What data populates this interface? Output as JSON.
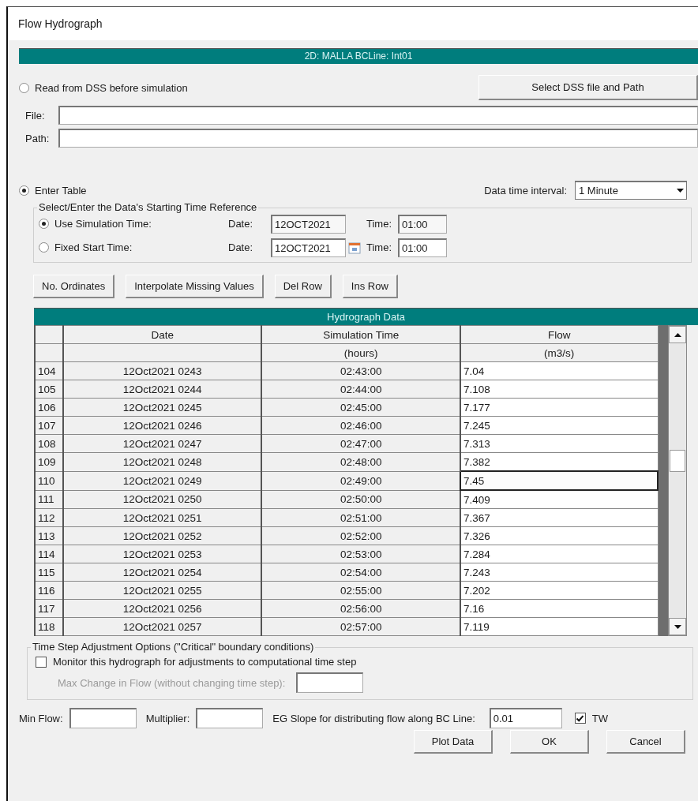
{
  "window": {
    "title": "Flow Hydrograph"
  },
  "header_bar": "2D: MALLA BCLine: Int01",
  "dss": {
    "label": "Read from DSS before simulation",
    "selected": false,
    "button": "Select DSS file and Path",
    "fields": [
      {
        "label": "File:"
      },
      {
        "label": "Path:"
      }
    ]
  },
  "table_entry": {
    "label": "Enter Table",
    "selected": true,
    "interval_label": "Data time interval:",
    "interval_value": "1 Minute"
  },
  "time_reference": {
    "legend": "Select/Enter the Data's Starting Time Reference",
    "options": [
      {
        "kind": "plain",
        "label": "Use Simulation Time:",
        "selected": true,
        "date_label": "Date:",
        "date": "12OCT2021",
        "time_label": "Time:",
        "time": "01:00"
      },
      {
        "kind": "calendar",
        "label": "Fixed Start Time:",
        "selected": false,
        "date_label": "Date:",
        "date": "12OCT2021",
        "time_label": "Time:",
        "time": "01:00"
      }
    ]
  },
  "toolbar": [
    "No. Ordinates",
    "Interpolate Missing Values",
    "Del Row",
    "Ins Row"
  ],
  "table": {
    "title": "Hydrograph Data",
    "columns": [
      {
        "label": "Date"
      },
      {
        "label": "Simulation Time",
        "unit": "(hours)"
      },
      {
        "label": "Flow",
        "unit": "(m3/s)"
      }
    ],
    "rows": [
      {
        "number": "104",
        "date": "12Oct2021 0243",
        "time": "02:43:00",
        "flow": "7.04",
        "selected": false
      },
      {
        "number": "105",
        "date": "12Oct2021 0244",
        "time": "02:44:00",
        "flow": "7.108",
        "selected": false
      },
      {
        "number": "106",
        "date": "12Oct2021 0245",
        "time": "02:45:00",
        "flow": "7.177",
        "selected": false
      },
      {
        "number": "107",
        "date": "12Oct2021 0246",
        "time": "02:46:00",
        "flow": "7.245",
        "selected": false
      },
      {
        "number": "108",
        "date": "12Oct2021 0247",
        "time": "02:47:00",
        "flow": "7.313",
        "selected": false
      },
      {
        "number": "109",
        "date": "12Oct2021 0248",
        "time": "02:48:00",
        "flow": "7.382",
        "selected": false
      },
      {
        "number": "110",
        "date": "12Oct2021 0249",
        "time": "02:49:00",
        "flow": "7.45",
        "selected": true
      },
      {
        "number": "111",
        "date": "12Oct2021 0250",
        "time": "02:50:00",
        "flow": "7.409",
        "selected": false
      },
      {
        "number": "112",
        "date": "12Oct2021 0251",
        "time": "02:51:00",
        "flow": "7.367",
        "selected": false
      },
      {
        "number": "113",
        "date": "12Oct2021 0252",
        "time": "02:52:00",
        "flow": "7.326",
        "selected": false
      },
      {
        "number": "114",
        "date": "12Oct2021 0253",
        "time": "02:53:00",
        "flow": "7.284",
        "selected": false
      },
      {
        "number": "115",
        "date": "12Oct2021 0254",
        "time": "02:54:00",
        "flow": "7.243",
        "selected": false
      },
      {
        "number": "116",
        "date": "12Oct2021 0255",
        "time": "02:55:00",
        "flow": "7.202",
        "selected": false
      },
      {
        "number": "117",
        "date": "12Oct2021 0256",
        "time": "02:56:00",
        "flow": "7.16",
        "selected": false
      },
      {
        "number": "118",
        "date": "12Oct2021 0257",
        "time": "02:57:00",
        "flow": "7.119",
        "selected": false
      }
    ]
  },
  "time_step": {
    "legend": "Time Step Adjustment Options (\"Critical\" boundary conditions)",
    "monitor": {
      "label": "Monitor this hydrograph for adjustments to computational time step",
      "checked": false
    },
    "max_change": {
      "label": "Max Change in Flow (without changing time step):",
      "disabled": true
    }
  },
  "bottom": {
    "min_flow_label": "Min Flow:",
    "multiplier_label": "Multiplier:",
    "eg_slope_label": "EG Slope for distributing flow along BC Line:",
    "eg_slope_value": "0.01",
    "tw": {
      "label": "TW",
      "checked": true
    }
  },
  "buttons": [
    "Plot Data",
    "OK",
    "Cancel"
  ]
}
